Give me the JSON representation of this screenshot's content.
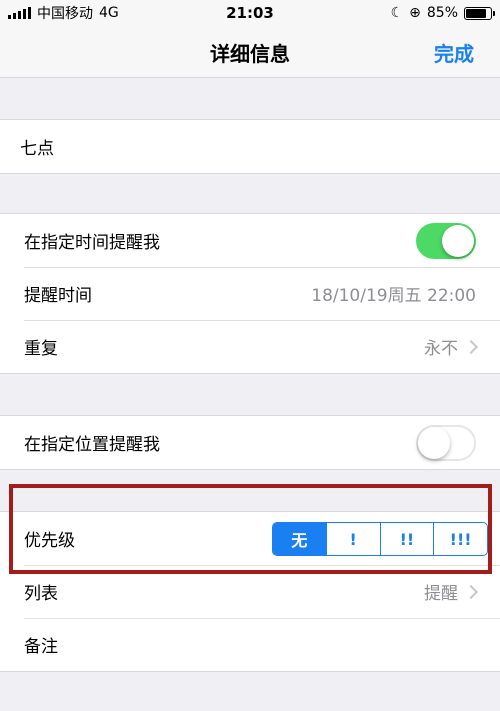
{
  "status_bar": {
    "carrier": "中国移动",
    "network": "4G",
    "time": "21:03",
    "battery_percent": "85%",
    "battery_level": 0.85
  },
  "nav": {
    "title": "详细信息",
    "done_label": "完成"
  },
  "title_field": {
    "value": "七点"
  },
  "time_reminder": {
    "label": "在指定时间提醒我",
    "enabled": true
  },
  "alarm": {
    "label": "提醒时间",
    "value": "18/10/19周五 22:00"
  },
  "repeat": {
    "label": "重复",
    "value": "永不"
  },
  "location_reminder": {
    "label": "在指定位置提醒我",
    "enabled": false
  },
  "priority": {
    "label": "优先级",
    "options": [
      "无",
      "!",
      "!!",
      "!!!"
    ],
    "selected_index": 0
  },
  "list": {
    "label": "列表",
    "value": "提醒"
  },
  "notes": {
    "label": "备注"
  },
  "colors": {
    "accent": "#1a7ff0",
    "toggle_on": "#4cd964",
    "highlight": "#a31d1d"
  }
}
